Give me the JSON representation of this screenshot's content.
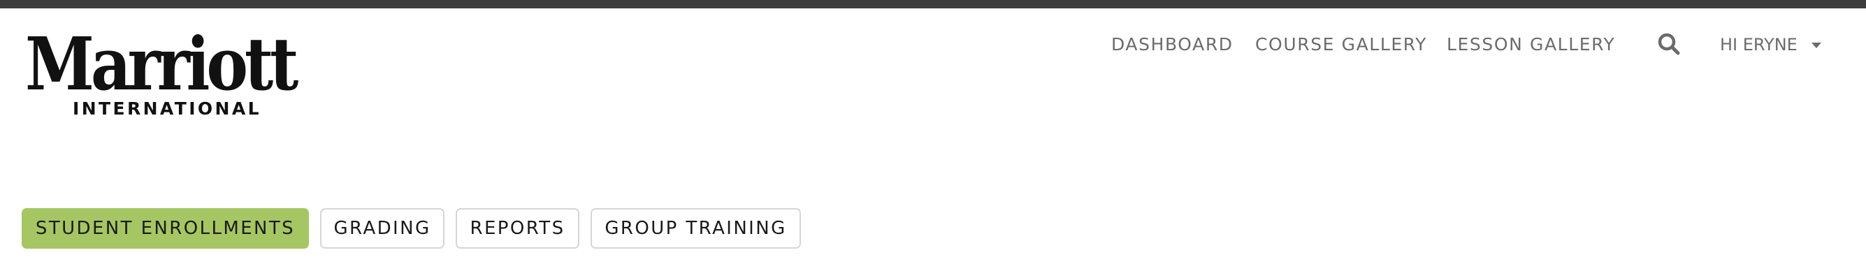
{
  "brand": {
    "logo_word": "Marriott",
    "logo_sub": "INTERNATIONAL"
  },
  "nav": {
    "links": [
      "DASHBOARD",
      "COURSE GALLERY",
      "LESSON GALLERY"
    ],
    "search_icon": "search-icon",
    "user_label": "HI ERYNE",
    "user_caret_icon": "caret-down-icon"
  },
  "tabs": [
    {
      "label": "STUDENT ENROLLMENTS",
      "active": true
    },
    {
      "label": "GRADING",
      "active": false
    },
    {
      "label": "REPORTS",
      "active": false
    },
    {
      "label": "GROUP TRAINING",
      "active": false
    }
  ],
  "colors": {
    "topbar": "#3d3d3d",
    "active_tab": "#a6c663",
    "nav_text": "#6b6b6b",
    "tab_border": "#d6d6d6"
  }
}
